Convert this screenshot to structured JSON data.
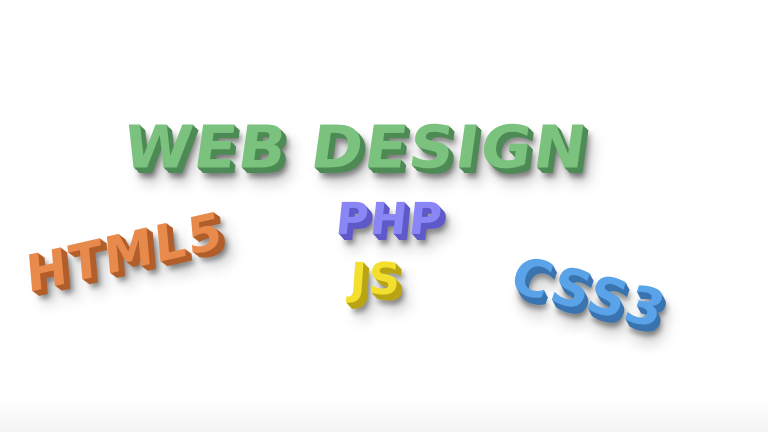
{
  "words": {
    "web_design": {
      "text": "WEB DESIGN",
      "face": "#7ac27d",
      "side": "#4e8a55"
    },
    "php": {
      "text": "PHP",
      "face": "#8a86f5",
      "side": "#5f59c9"
    },
    "js": {
      "text": "JS",
      "face": "#f3df2e",
      "side": "#b9a414"
    },
    "html5": {
      "text": "HTML5",
      "face": "#e98a4d",
      "side": "#b25e2a"
    },
    "css3": {
      "text": "CSS3",
      "face": "#5aa3e8",
      "side": "#3a74b0"
    }
  }
}
